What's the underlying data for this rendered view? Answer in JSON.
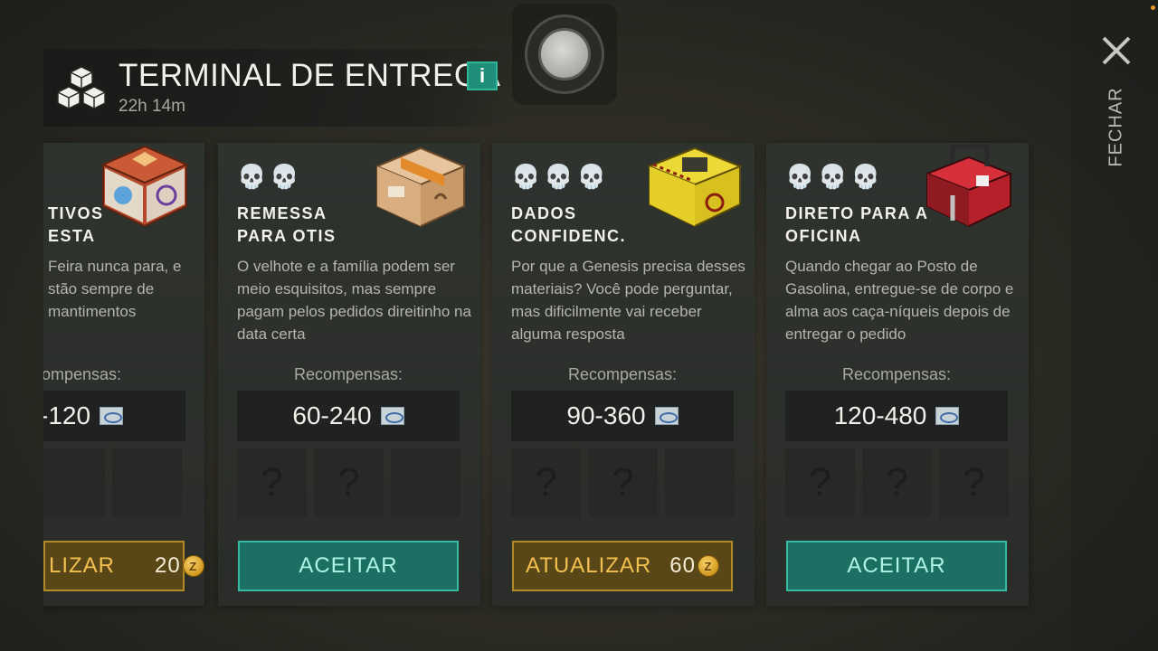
{
  "header": {
    "title": "TERMINAL DE ENTREGA",
    "info_label": "i",
    "timer": "22h 14m"
  },
  "close": {
    "label": "FECHAR"
  },
  "rewards_label_full": "Recompensas:",
  "cards": [
    {
      "title": "TIVOS\nESTA",
      "description": "Feira nunca para, e stão sempre de mantimentos",
      "rewards_label": "ompensas:",
      "reward": "-120",
      "skulls": 0,
      "button": {
        "type": "update",
        "label": "LIZAR",
        "cost": "20"
      }
    },
    {
      "title": "REMESSA\nPARA OTIS",
      "description": "O velhote e a família podem ser meio esquisitos, mas sempre pagam pelos pedidos direitinho na data certa",
      "reward": "60-240",
      "skulls": 2,
      "button": {
        "type": "accept",
        "label": "ACEITAR"
      }
    },
    {
      "title": "DADOS\nCONFIDENC.",
      "description": "Por que a Genesis precisa desses materiais? Você pode perguntar, mas dificilmente vai receber alguma resposta",
      "reward": "90-360",
      "skulls": 3,
      "button": {
        "type": "update",
        "label": "ATUALIZAR",
        "cost": "60"
      }
    },
    {
      "title": "DIRETO PARA A\nOFICINA",
      "description": "Quando chegar ao Posto de Gasolina, entregue-se de corpo e alma aos caça-níqueis depois de entregar o pedido",
      "reward": "120-480",
      "skulls": 3,
      "button": {
        "type": "accept",
        "label": "ACEITAR"
      }
    }
  ],
  "icons": {
    "header": "boxes-icon",
    "close": "close-icon",
    "skull": "skull-icon",
    "reward": "ticket-icon",
    "coin": "coin-icon",
    "slot": "question-mark-icon"
  },
  "colors": {
    "accept": "#1c6f63",
    "update": "#5a4718",
    "info": "#1f8f7a"
  },
  "slot_glyph": "?",
  "skull_glyph": "💀",
  "coin_glyph": "Z"
}
